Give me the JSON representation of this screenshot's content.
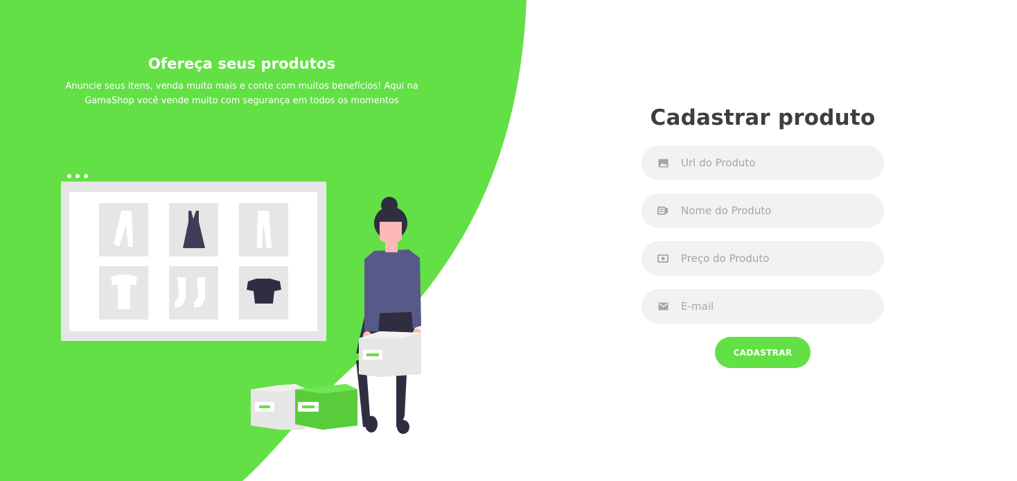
{
  "colors": {
    "brand_green": "#63e045",
    "title_dark": "#3e3e3e",
    "field_bg": "#f2f2f2",
    "placeholder": "#a5a5a5"
  },
  "hero": {
    "title": "Ofereça seus produtos",
    "text": "Anuncie seus itens, venda muito mais e conte com muitos benefícios! Aqui na GamaShop você vende muito com segurança em todos os momentos"
  },
  "form": {
    "title": "Cadastrar produto",
    "fields": [
      {
        "icon": "image-icon",
        "placeholder": "Url do Produto",
        "value": ""
      },
      {
        "icon": "tag-icon",
        "placeholder": "Nome do Produto",
        "value": ""
      },
      {
        "icon": "money-icon",
        "placeholder": "Preço do Produto",
        "value": ""
      },
      {
        "icon": "mail-icon",
        "placeholder": "E-mail",
        "value": ""
      }
    ],
    "submit_label": "CADASTRAR"
  }
}
